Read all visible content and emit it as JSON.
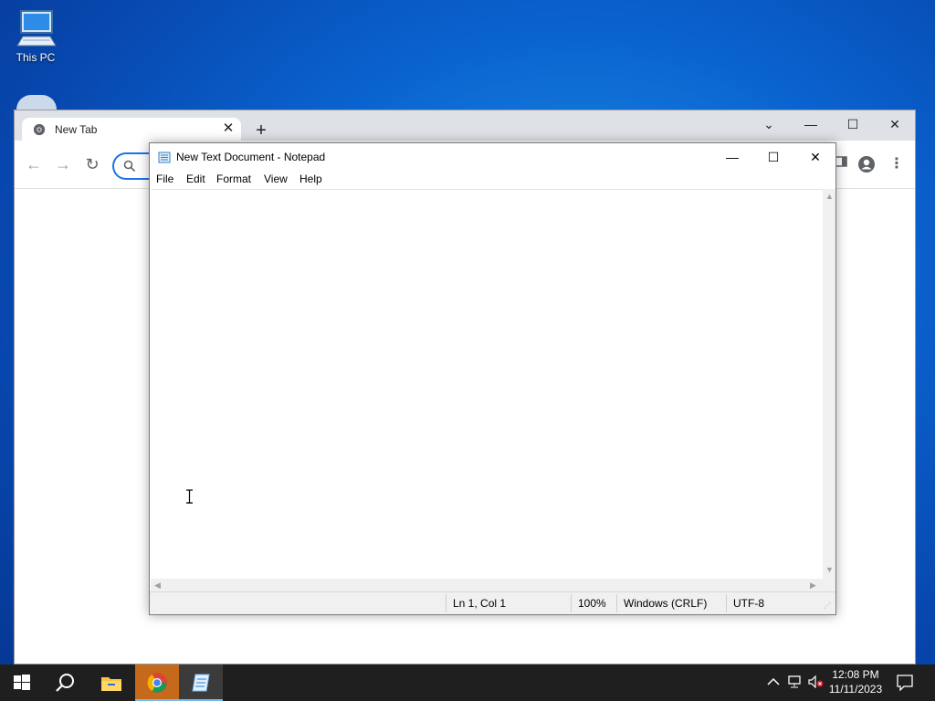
{
  "desktop": {
    "icons": [
      {
        "label": "This PC",
        "icon": "computer-icon"
      }
    ]
  },
  "chrome": {
    "tab": {
      "title": "New Tab",
      "icon": "chrome-icon"
    },
    "controls": {
      "new_tab": "+",
      "dropdown": "⌄",
      "minimize": "—",
      "maximize": "☐",
      "close": "✕"
    },
    "nav": {
      "back": "←",
      "forward": "→",
      "reload": "↻"
    }
  },
  "notepad": {
    "title": "New Text Document - Notepad",
    "menu": [
      "File",
      "Edit",
      "Format",
      "View",
      "Help"
    ],
    "content": "",
    "status": {
      "position": "Ln 1, Col 1",
      "zoom": "100%",
      "line_ending": "Windows (CRLF)",
      "encoding": "UTF-8"
    }
  },
  "taskbar": {
    "apps": [
      "start-icon",
      "search-icon",
      "file-explorer-icon",
      "chrome-icon",
      "notepad-icon"
    ],
    "clock": {
      "time": "12:08 PM",
      "date": "11/11/2023"
    }
  },
  "colors": {
    "desktop_blue": "#0a63cf",
    "chrome_accent": "#1a73e8",
    "taskbar": "#1f1f1f",
    "taskbar_active_underline": "#76b9ed"
  }
}
